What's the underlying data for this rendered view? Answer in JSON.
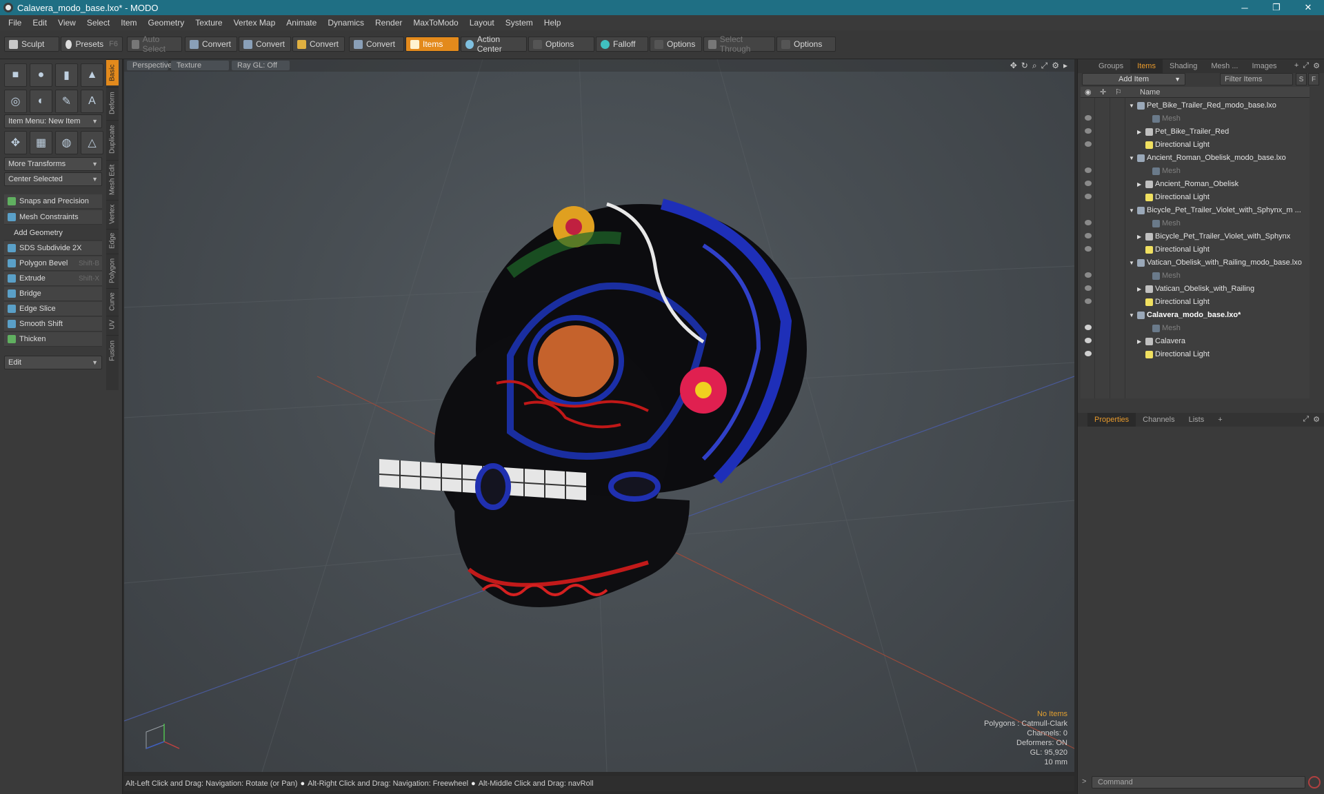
{
  "window": {
    "title": "Calavera_modo_base.lxo* - MODO",
    "minimize": "─",
    "restore": "❐",
    "close": "✕"
  },
  "menu": [
    "File",
    "Edit",
    "View",
    "Select",
    "Item",
    "Geometry",
    "Texture",
    "Vertex Map",
    "Animate",
    "Dynamics",
    "Render",
    "MaxToModo",
    "Layout",
    "System",
    "Help"
  ],
  "toolbar": {
    "sculpt": "Sculpt",
    "presets": "Presets",
    "presets_shortcut": "F6",
    "auto_select": "Auto Select",
    "convert1": "Convert",
    "convert2": "Convert",
    "convert3": "Convert",
    "convert4": "Convert",
    "items": "Items",
    "action_center": "Action Center",
    "options1": "Options",
    "falloff": "Falloff",
    "options2": "Options",
    "select_through": "Select Through",
    "options3": "Options"
  },
  "left_panel": {
    "item_menu": "Item Menu: New Item",
    "more_transforms": "More Transforms",
    "center_selected": "Center Selected",
    "snaps": "Snaps and Precision",
    "mesh_constraints": "Mesh Constraints",
    "add_geometry": "Add Geometry",
    "tools": [
      {
        "label": "SDS Subdivide 2X",
        "shortcut": ""
      },
      {
        "label": "Polygon Bevel",
        "shortcut": "Shift-B"
      },
      {
        "label": "Extrude",
        "shortcut": "Shift-X"
      },
      {
        "label": "Bridge",
        "shortcut": ""
      },
      {
        "label": "Edge Slice",
        "shortcut": ""
      },
      {
        "label": "Smooth Shift",
        "shortcut": ""
      },
      {
        "label": "Thicken",
        "shortcut": ""
      }
    ],
    "edit_dropdown": "Edit",
    "vertical_tabs": [
      "Basic",
      "Deform",
      "Duplicate",
      "Mesh Edit",
      "Vertex",
      "Edge",
      "Polygon",
      "Curve",
      "UV",
      "Fusion"
    ]
  },
  "viewport": {
    "tabs": [
      "Perspective",
      "Texture",
      "Ray GL: Off"
    ],
    "info": {
      "selection": "No Items",
      "polygons": "Polygons : Catmull-Clark",
      "channels": "Channels: 0",
      "deformers": "Deformers: ON",
      "gl": "GL: 95,920",
      "scale": "10 mm"
    }
  },
  "right_panel": {
    "tabs": [
      "Groups",
      "Items",
      "Shading",
      "Mesh ...",
      "Images"
    ],
    "add_item": "Add Item",
    "filter_placeholder": "Filter Items",
    "s_btn": "S",
    "f_btn": "F",
    "name_header": "Name",
    "tree": [
      {
        "label": "Pet_Bike_Trailer_Red_modo_base.lxo",
        "level": 0,
        "type": "scene",
        "eye": false
      },
      {
        "label": "Mesh",
        "level": 2,
        "type": "mesh",
        "eye": true,
        "dim": true
      },
      {
        "label": "Pet_Bike_Trailer_Red",
        "level": 1,
        "type": "group",
        "eye": true
      },
      {
        "label": "Directional Light",
        "level": 1,
        "type": "light",
        "eye": true
      },
      {
        "label": "Ancient_Roman_Obelisk_modo_base.lxo",
        "level": 0,
        "type": "scene",
        "eye": false
      },
      {
        "label": "Mesh",
        "level": 2,
        "type": "mesh",
        "eye": true,
        "dim": true
      },
      {
        "label": "Ancient_Roman_Obelisk",
        "level": 1,
        "type": "group",
        "eye": true
      },
      {
        "label": "Directional Light",
        "level": 1,
        "type": "light",
        "eye": true
      },
      {
        "label": "Bicycle_Pet_Trailer_Violet_with_Sphynx_m ...",
        "level": 0,
        "type": "scene",
        "eye": false
      },
      {
        "label": "Mesh",
        "level": 2,
        "type": "mesh",
        "eye": true,
        "dim": true
      },
      {
        "label": "Bicycle_Pet_Trailer_Violet_with_Sphynx",
        "level": 1,
        "type": "group",
        "eye": true
      },
      {
        "label": "Directional Light",
        "level": 1,
        "type": "light",
        "eye": true
      },
      {
        "label": "Vatican_Obelisk_with_Railing_modo_base.lxo",
        "level": 0,
        "type": "scene",
        "eye": false
      },
      {
        "label": "Mesh",
        "level": 2,
        "type": "mesh",
        "eye": true,
        "dim": true
      },
      {
        "label": "Vatican_Obelisk_with_Railing",
        "level": 1,
        "type": "group",
        "eye": true
      },
      {
        "label": "Directional Light",
        "level": 1,
        "type": "light",
        "eye": true
      },
      {
        "label": "Calavera_modo_base.lxo*",
        "level": 0,
        "type": "scene",
        "eye": false,
        "bold": true
      },
      {
        "label": "Mesh",
        "level": 2,
        "type": "mesh",
        "eye": true,
        "on": true,
        "dim": true
      },
      {
        "label": "Calavera",
        "level": 1,
        "type": "group",
        "eye": true,
        "on": true
      },
      {
        "label": "Directional Light",
        "level": 1,
        "type": "light",
        "eye": true,
        "on": true
      }
    ],
    "prop_tabs": [
      "Properties",
      "Channels",
      "Lists"
    ],
    "command_placeholder": "Command",
    "command_prompt": ">"
  },
  "status": {
    "hint1": "Alt-Left Click and Drag: Navigation: Rotate (or Pan)",
    "hint2": "Alt-Right Click and Drag: Navigation: Freewheel",
    "hint3": "Alt-Middle Click and Drag: navRoll"
  },
  "colors": {
    "titlebar": "#1f6f84",
    "accent": "#e38a1c"
  }
}
